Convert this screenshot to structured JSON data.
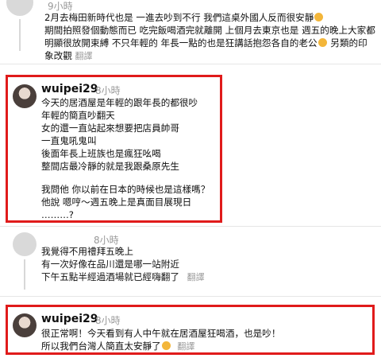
{
  "comment1": {
    "time": "9小時",
    "lines": [
      "2月去梅田新時代也是 一進去吵到不行 我們這桌外國人反而很安靜",
      "期間拍照發個動態而已 吃完飯喝酒完就離開 上個月去東京也是 週五的晚上大家都明顯很放開束縛 不只年輕的 年長一點的也是狂講話抱怨各自的老公",
      "另類的印象改觀"
    ],
    "translate": "翻譯"
  },
  "comment2": {
    "username": "wuipei29",
    "time": "8小時",
    "lines": [
      "今天的居酒屋是年輕的跟年長的都很吵",
      "年輕的簡直吵翻天",
      "女的還一直站起來想要把店員帥哥",
      "一直鬼吼鬼叫",
      "後面年長上班族也是瘋狂吆喝",
      "整間店最冷靜的就是我跟桑原先生"
    ],
    "lines2": [
      "我問他 你以前在日本的時候也是這樣嗎？",
      "他說 嗯哼～週五晚上是真面目展現日",
      "………?"
    ]
  },
  "comment3": {
    "time": "8小時",
    "lines": [
      "我覺得不用禮拜五晚上",
      "有一次好像在品川還是哪一站附近",
      "下午五點半經過酒場就已經嗨翻了"
    ],
    "translate": "翻譯"
  },
  "comment4": {
    "username": "wuipei29",
    "time": "8小時",
    "lines": [
      "很正常啊！今天看到有人中午就在居酒屋狂喝酒，也是吵！",
      "所以我們台灣人簡直太安靜了"
    ],
    "translate": "翻譯"
  },
  "colors": {
    "highlight": "#e01b1b",
    "muted": "#999999"
  }
}
